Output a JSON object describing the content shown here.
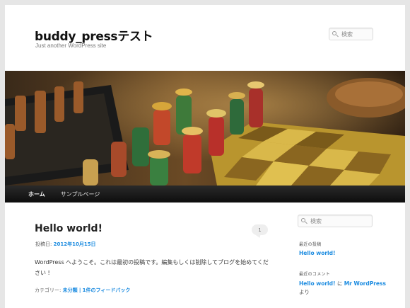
{
  "site": {
    "title": "buddy_pressテスト",
    "description": "Just another WordPress site"
  },
  "search": {
    "placeholder": "検索"
  },
  "nav": {
    "items": [
      "ホーム",
      "サンプルページ"
    ]
  },
  "post": {
    "title": "Hello world!",
    "comment_count": "1",
    "meta_prefix": "投稿日:",
    "date": "2012年10月15日",
    "content": "WordPress へようこそ。これは最初の投稿です。編集もしくは削除してブログを始めてください !",
    "category_prefix": "カテゴリー:",
    "category": "未分類",
    "separator": "|",
    "feedback": "1件のフィードバック"
  },
  "sidebar": {
    "search_placeholder": "検索",
    "recent_posts_title": "最近の投稿",
    "recent_posts": [
      "Hello world!"
    ],
    "recent_comments_title": "最近のコメント",
    "recent_comment": {
      "post": "Hello world!",
      "on": "に",
      "author": "Mr WordPress",
      "suffix": "より"
    }
  },
  "colors": {
    "link": "#1b8be0",
    "nav_bg": "#1a1a1a",
    "page_bg": "#e6e6e6"
  }
}
